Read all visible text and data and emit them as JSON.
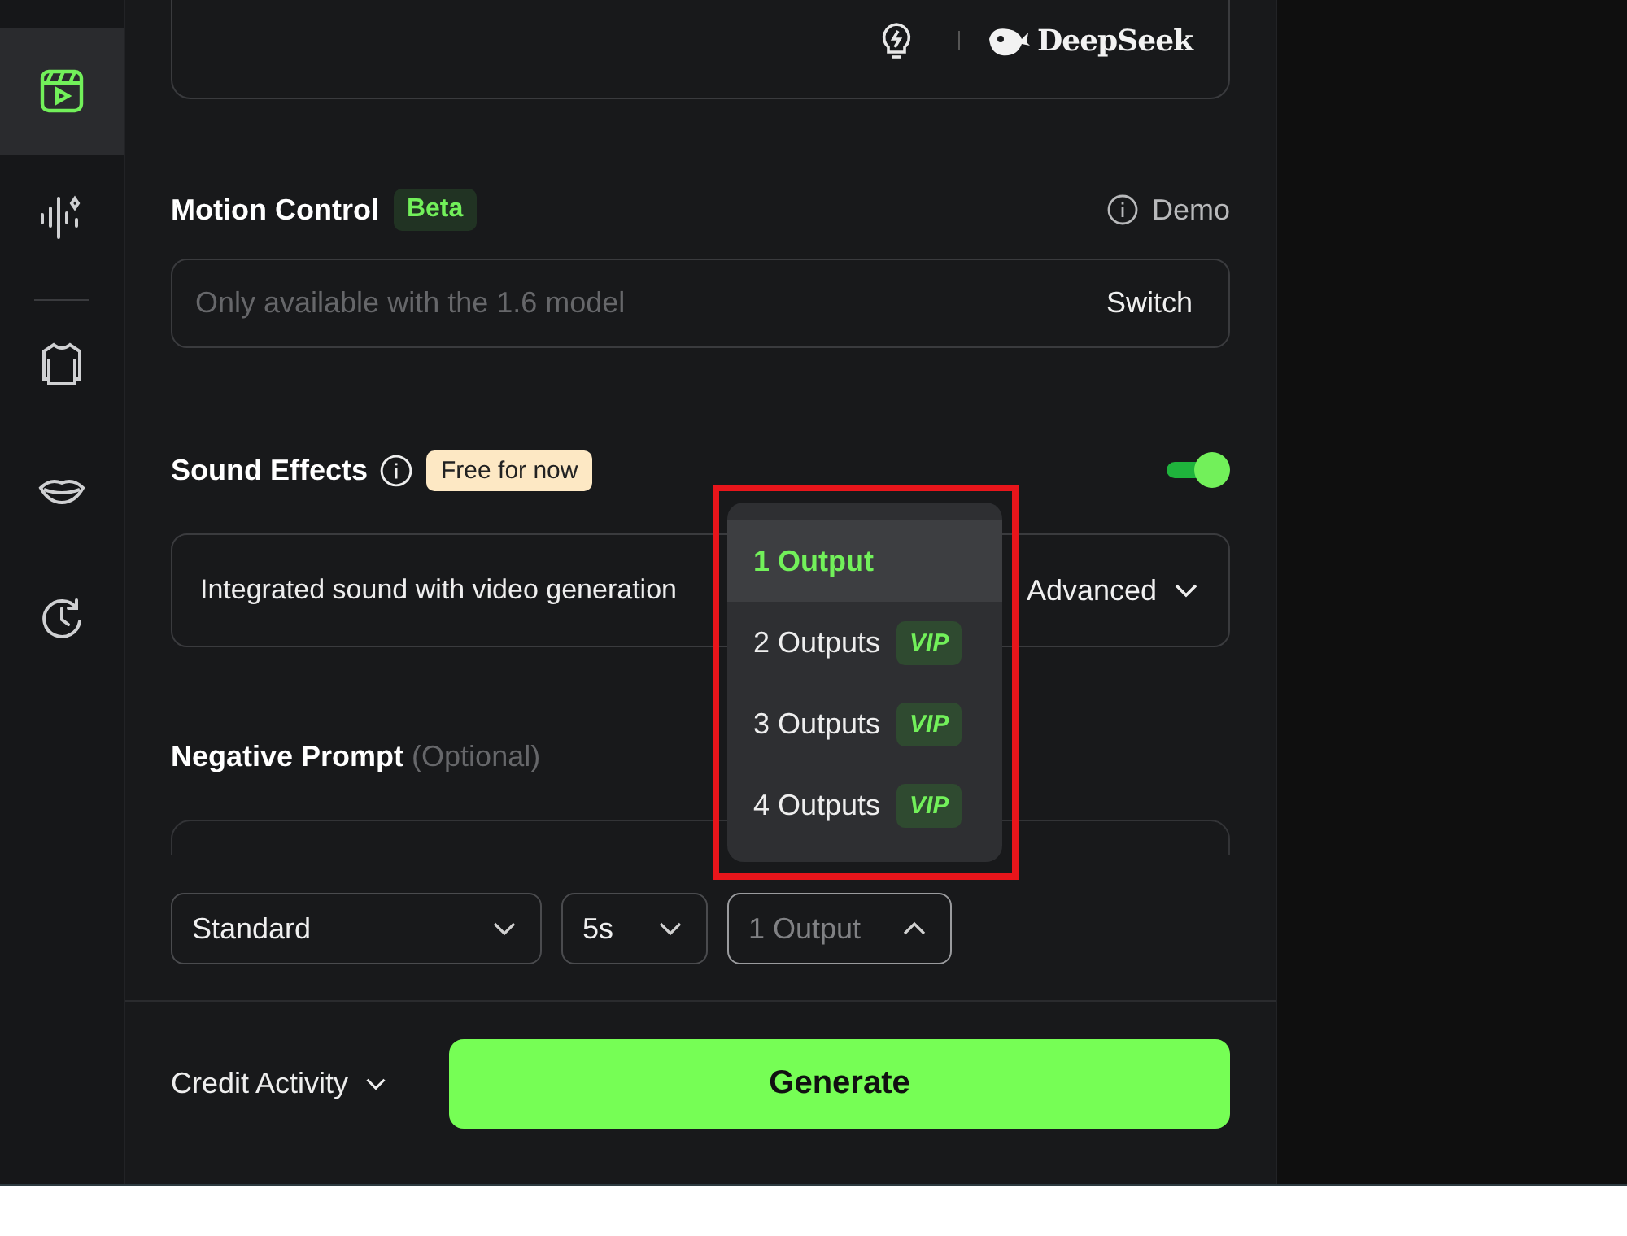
{
  "sidebar": [
    {
      "kind": "video",
      "selected": true
    },
    {
      "kind": "audio",
      "selected": false
    },
    {
      "kind": "shirt",
      "selected": false
    },
    {
      "kind": "lips",
      "selected": false
    },
    {
      "kind": "history",
      "selected": false
    }
  ],
  "prompt_box": {
    "logo": "DeepSeek"
  },
  "motion_control": {
    "title": "Motion Control",
    "badge": "Beta",
    "demo": "Demo",
    "placeholder": "Only available with the 1.6 model",
    "action": "Switch"
  },
  "sound_effects": {
    "title": "Sound Effects",
    "badge": "Free for now",
    "on": true,
    "description": "Integrated sound with video generation",
    "advanced": "Advanced"
  },
  "negative_prompt": {
    "title": "Negative Prompt",
    "hint": "(Optional)"
  },
  "selects": [
    {
      "value": "Standard",
      "open": false
    },
    {
      "value": "5s",
      "open": false
    },
    {
      "value": "1 Output",
      "open": true
    }
  ],
  "output_menu": [
    {
      "label": "1 Output",
      "selected": true
    },
    {
      "label": "2 Outputs",
      "selected": false,
      "badge": "VIP"
    },
    {
      "label": "3 Outputs",
      "selected": false,
      "badge": "VIP"
    },
    {
      "label": "4 Outputs",
      "selected": false,
      "badge": "VIP"
    }
  ],
  "footer": {
    "credit": "Credit Activity",
    "generate": "Generate"
  }
}
